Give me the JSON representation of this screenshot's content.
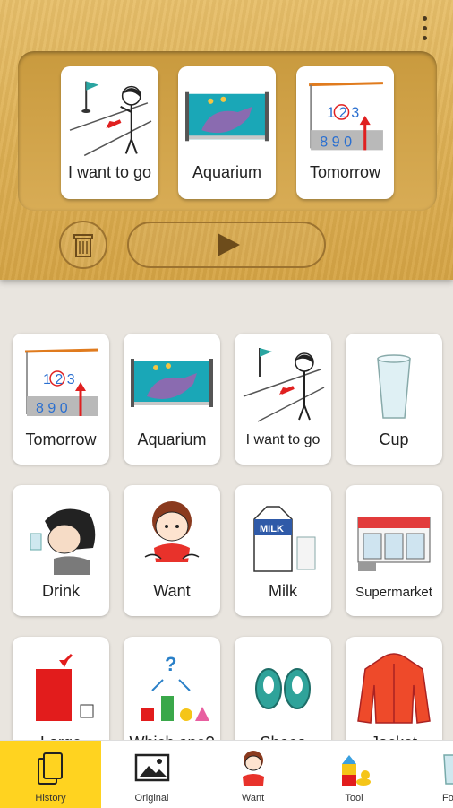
{
  "sentence": {
    "cards": [
      {
        "label": "I want to go",
        "icon": "person-pointing-flag-icon"
      },
      {
        "label": "Aquarium",
        "icon": "aquarium-fish-icon"
      },
      {
        "label": "Tomorrow",
        "icon": "calendar-tomorrow-icon"
      }
    ],
    "delete_icon": "trash-icon",
    "play_icon": "play-icon"
  },
  "grid": [
    {
      "label": "Tomorrow",
      "icon": "calendar-tomorrow-icon"
    },
    {
      "label": "Aquarium",
      "icon": "aquarium-fish-icon"
    },
    {
      "label": "I want to go",
      "icon": "person-pointing-flag-icon"
    },
    {
      "label": "Cup",
      "icon": "cup-icon"
    },
    {
      "label": "Drink",
      "icon": "person-drinking-icon"
    },
    {
      "label": "Want",
      "icon": "girl-want-icon"
    },
    {
      "label": "Milk",
      "icon": "milk-carton-icon"
    },
    {
      "label": "Supermarket",
      "icon": "supermarket-icon"
    },
    {
      "label": "Large",
      "icon": "large-small-icon"
    },
    {
      "label": "Which one?",
      "icon": "which-one-icon"
    },
    {
      "label": "Shoes",
      "icon": "shoes-icon"
    },
    {
      "label": "Jacket",
      "icon": "jacket-icon"
    }
  ],
  "nav": {
    "items": [
      {
        "label": "History",
        "icon": "history-cards-icon",
        "active": true
      },
      {
        "label": "Original",
        "icon": "image-frame-icon",
        "active": false
      },
      {
        "label": "Want",
        "icon": "girl-want-icon",
        "active": false
      },
      {
        "label": "Tool",
        "icon": "toy-blocks-icon",
        "active": false
      },
      {
        "label": "Fo",
        "icon": "glass-icon",
        "active": false
      }
    ]
  },
  "colors": {
    "wood": "#dcae52",
    "active_tab": "#ffd320",
    "background": "#e9e5df"
  }
}
